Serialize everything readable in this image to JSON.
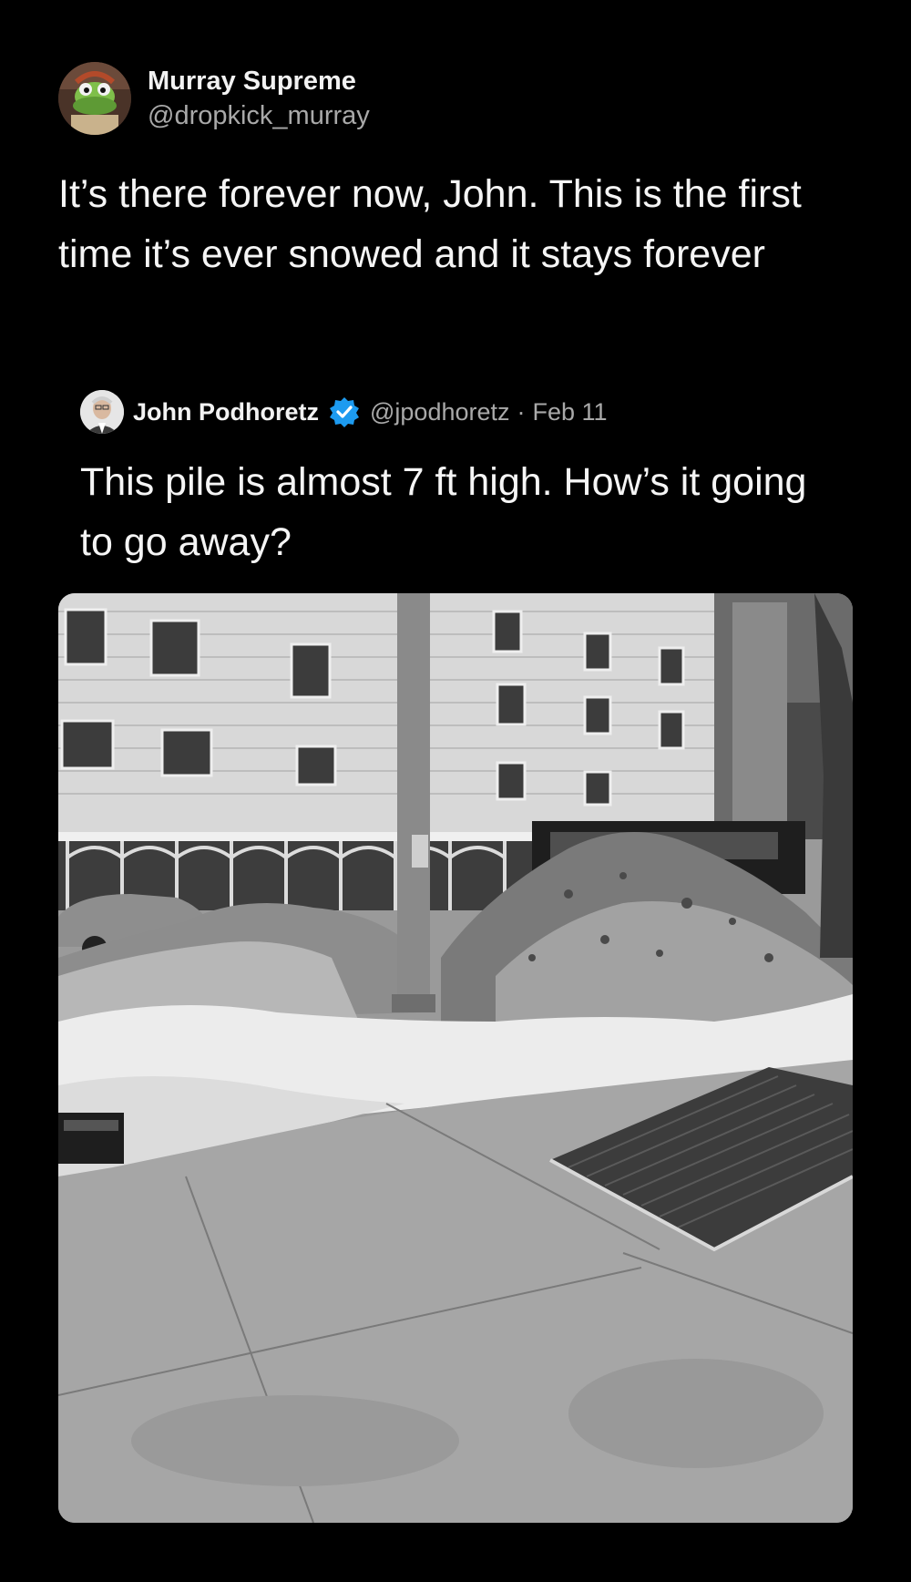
{
  "post": {
    "author": {
      "name": "Murray Supreme",
      "handle": "@dropkick_murray",
      "avatar_icon": "green-puppet-avatar"
    },
    "text": "It’s there forever now, John. This is the first time it’s ever snowed and it stays forever"
  },
  "quoted_post": {
    "author": {
      "name": "John Podhoretz",
      "handle": "@jpodhoretz",
      "separator": "·",
      "date": "Feb 11",
      "verified": true,
      "verified_color": "#1d9bf0",
      "avatar_icon": "man-portrait-avatar"
    },
    "text": "This pile is almost 7 ft high. How’s it going to go away?",
    "media": {
      "type": "photo",
      "description_icon": "snow-pile-street-photo",
      "style": "grayscale"
    }
  },
  "colors": {
    "background": "#000000",
    "text_primary": "#f5f5f5",
    "text_secondary": "#a9a9a9"
  }
}
